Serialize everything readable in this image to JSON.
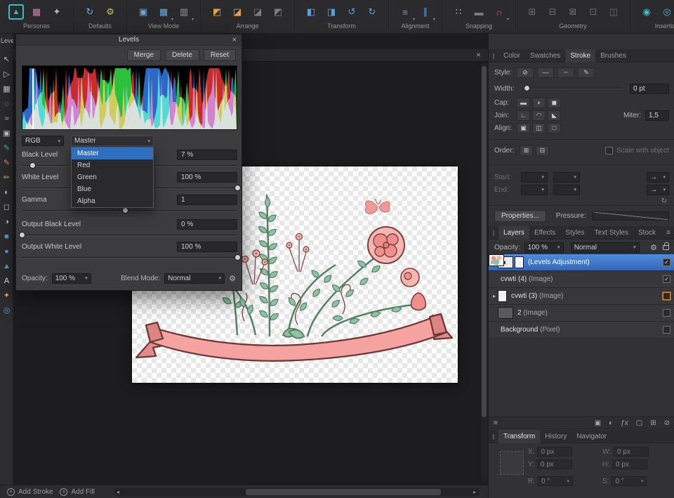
{
  "icons": {
    "close": "×",
    "chevron_down": "▾",
    "caret_right": "▸",
    "check": "✓",
    "gear": "⚙",
    "menu": "≡",
    "half_circle": "◐",
    "plus": "+",
    "tri_left": "◂",
    "tri_right": "▸",
    "handle": "∥",
    "arrow_right": "→",
    "refresh": "↻"
  },
  "window": {
    "clipped_panel_label": "Level"
  },
  "toolbar": {
    "groups": [
      {
        "label": "Personas",
        "icons": [
          {
            "name": "affinity-photo-logo-icon",
            "glyph": "▲",
            "color": "#35c0c8",
            "boxed": true
          },
          {
            "name": "persona-develop-icon",
            "glyph": "▦",
            "color": "#c585b5"
          },
          {
            "name": "persona-export-icon",
            "glyph": "✦",
            "color": "#b9b9b9"
          }
        ]
      },
      {
        "label": "Defaults",
        "icons": [
          {
            "name": "defaults-sync-icon",
            "glyph": "↻",
            "color": "#6fa8dc"
          },
          {
            "name": "defaults-revert-icon",
            "glyph": "⚙",
            "color": "#d4b95e"
          }
        ]
      },
      {
        "label": "View Mode",
        "icons": [
          {
            "name": "view-mode-vector-icon",
            "glyph": "▣",
            "color": "#6fa8dc"
          },
          {
            "name": "view-mode-pixel-icon",
            "glyph": "▦",
            "color": "#6fa8dc",
            "arrow": true
          },
          {
            "name": "view-mode-retina-icon",
            "glyph": "▥",
            "color": "#9a9a9a",
            "arrow": true
          }
        ]
      },
      {
        "label": "Arrange",
        "icons": [
          {
            "name": "arrange-to-front-icon",
            "glyph": "◩",
            "color": "#e8a33d"
          },
          {
            "name": "arrange-forward-icon",
            "glyph": "◪",
            "color": "#e8a33d"
          },
          {
            "name": "arrange-backward-icon",
            "glyph": "◪",
            "color": "#7c7c7c"
          },
          {
            "name": "arrange-to-back-icon",
            "glyph": "◩",
            "color": "#7c7c7c"
          }
        ]
      },
      {
        "label": "Transform",
        "icons": [
          {
            "name": "flip-horizontal-icon",
            "glyph": "◧",
            "color": "#5a9fdc"
          },
          {
            "name": "flip-vertical-icon",
            "glyph": "◨",
            "color": "#5a9fdc"
          },
          {
            "name": "rotate-ccw-icon",
            "glyph": "↺",
            "color": "#5a9fdc"
          },
          {
            "name": "rotate-cw-icon",
            "glyph": "↻",
            "color": "#5a9fdc"
          }
        ]
      },
      {
        "label": "Alignment",
        "icons": [
          {
            "name": "align-horizontal-icon",
            "glyph": "≡",
            "color": "#5a9fdc",
            "arrow": true
          },
          {
            "name": "align-vertical-icon",
            "glyph": "∥",
            "color": "#5a9fdc",
            "arrow": true
          }
        ]
      },
      {
        "label": "Snapping",
        "icons": [
          {
            "name": "snapping-grid-icon",
            "glyph": "∷",
            "color": "#b9b9b9"
          },
          {
            "name": "snapping-toggle-icon",
            "glyph": "▬",
            "color": "#7c7c7c"
          },
          {
            "name": "snapping-magnet-icon",
            "glyph": "∩",
            "color": "#d05c5c",
            "arrow": true
          }
        ]
      },
      {
        "label": "Geometry",
        "icons": [
          {
            "name": "geometry-add-icon",
            "glyph": "⊞",
            "color": "#6e6e6e"
          },
          {
            "name": "geometry-subtract-icon",
            "glyph": "⊟",
            "color": "#6e6e6e"
          },
          {
            "name": "geometry-intersect-icon",
            "glyph": "⊠",
            "color": "#6e6e6e"
          },
          {
            "name": "geometry-divide-icon",
            "glyph": "⊡",
            "color": "#6e6e6e"
          },
          {
            "name": "geometry-combine-icon",
            "glyph": "◫",
            "color": "#6e6e6e"
          }
        ]
      },
      {
        "label": "Insertion",
        "icons": [
          {
            "name": "insert-inside-icon",
            "glyph": "◉",
            "color": "#35c0c8"
          },
          {
            "name": "insert-on-top-icon",
            "glyph": "◎",
            "color": "#35c0c8"
          },
          {
            "name": "insert-behind-icon",
            "glyph": "●",
            "color": "#35c0c8"
          }
        ]
      }
    ]
  },
  "tools": [
    {
      "name": "move-tool",
      "glyph": "↖",
      "color": "#cfcfcf"
    },
    {
      "name": "node-tool",
      "glyph": "▷",
      "color": "#cfcfcf"
    },
    {
      "name": "rectangle-marquee-tool",
      "glyph": "▦",
      "color": "#cfcfcf"
    },
    {
      "name": "freehand-selection-tool",
      "glyph": "◌",
      "color": "#cfcfcf"
    },
    {
      "name": "flood-select-tool",
      "glyph": "≈",
      "color": "#cfcfcf"
    },
    {
      "name": "crop-tool",
      "glyph": "▣",
      "color": "#cfcfcf"
    },
    {
      "name": "selection-brush-tool",
      "glyph": "✎",
      "color": "#3fc3ca"
    },
    {
      "name": "paint-brush-tool",
      "glyph": "✎",
      "color": "#e0907f"
    },
    {
      "name": "pixel-tool",
      "glyph": "✏",
      "color": "#d8b35a"
    },
    {
      "name": "clone-brush-tool",
      "glyph": "◐",
      "color": "#cfcfcf"
    },
    {
      "name": "erase-brush-tool",
      "glyph": "◻",
      "color": "#cfcfcf"
    },
    {
      "name": "dodge-brush-tool",
      "glyph": "◑",
      "color": "#cfcfcf"
    },
    {
      "name": "rectangle-tool",
      "glyph": "■",
      "color": "#5a9fdc"
    },
    {
      "name": "ellipse-tool",
      "glyph": "●",
      "color": "#5a9fdc"
    },
    {
      "name": "triangle-tool",
      "glyph": "▲",
      "color": "#5a9fdc"
    },
    {
      "name": "artistic-text-tool",
      "glyph": "A",
      "color": "#e8e8e8"
    },
    {
      "name": "colour-picker-tool",
      "glyph": "✦",
      "color": "#d8b35a"
    },
    {
      "name": "zoom-tool",
      "glyph": "◎",
      "color": "#5a9fdc"
    }
  ],
  "levels_dialog": {
    "title": "Levels",
    "merge_label": "Merge",
    "delete_label": "Delete",
    "reset_label": "Reset",
    "channel_select": {
      "value": "RGB"
    },
    "channel_dropdown": {
      "value": "Master",
      "options": [
        "Master",
        "Red",
        "Green",
        "Blue",
        "Alpha"
      ],
      "selected_index": 0
    },
    "sliders": [
      {
        "label": "Black Level",
        "value": "7 %",
        "position_pct": 5
      },
      {
        "label": "White Level",
        "value": "100 %",
        "position_pct": 100
      },
      {
        "label": "Gamma",
        "value": "1",
        "position_pct": 48
      },
      {
        "label": "Output Black Level",
        "value": "0 %",
        "position_pct": 0
      },
      {
        "label": "Output White Level",
        "value": "100 %",
        "position_pct": 100
      }
    ],
    "footer": {
      "opacity_label": "Opacity:",
      "opacity_value": "100 %",
      "blend_label": "Blend Mode:",
      "blend_value": "Normal"
    }
  },
  "right_panel": {
    "tabs": {
      "items": [
        "Color",
        "Swatches",
        "Stroke",
        "Brushes"
      ],
      "active": 2
    },
    "stroke": {
      "style_label": "Style:",
      "style_buttons": [
        {
          "name": "style-none-icon",
          "glyph": "⊘"
        },
        {
          "name": "style-solid-icon",
          "glyph": "—"
        },
        {
          "name": "style-dash-icon",
          "glyph": "╌"
        },
        {
          "name": "style-texture-icon",
          "glyph": "✎"
        }
      ],
      "width_label": "Width:",
      "width_value": "0 pt",
      "cap_label": "Cap:",
      "cap_buttons": [
        {
          "name": "cap-butt-icon",
          "glyph": "▬"
        },
        {
          "name": "cap-round-icon",
          "glyph": "◗"
        },
        {
          "name": "cap-square-icon",
          "glyph": "◼"
        }
      ],
      "join_label": "Join:",
      "join_buttons": [
        {
          "name": "join-miter-icon",
          "glyph": "∟"
        },
        {
          "name": "join-round-icon",
          "glyph": "◠"
        },
        {
          "name": "join-bevel-icon",
          "glyph": "◣"
        }
      ],
      "miter_label": "Miter:",
      "miter_value": "1,5",
      "align_label": "Align:",
      "align_buttons": [
        {
          "name": "align-center-icon",
          "glyph": "▣"
        },
        {
          "name": "align-inside-icon",
          "glyph": "◫"
        },
        {
          "name": "align-outside-icon",
          "glyph": "□"
        }
      ],
      "order_label": "Order:",
      "order_buttons": [
        {
          "name": "order-stroke-front-icon",
          "glyph": "⊞"
        },
        {
          "name": "order-stroke-back-icon",
          "glyph": "⊟"
        }
      ],
      "scale_with_object_label": "Scale with object",
      "start_label": "Start:",
      "end_label": "End:",
      "properties_button": "Properties...",
      "pressure_label": "Pressure:"
    },
    "layers_panel": {
      "tabs": {
        "items": [
          "Layers",
          "Effects",
          "Styles",
          "Text Styles",
          "Stock"
        ],
        "active": 0
      },
      "opacity_label": "Opacity:",
      "opacity_value": "100 %",
      "blend_value": "Normal",
      "layers": [
        {
          "name": "(Levels Adjustment)",
          "thumbs": [
            "adjust",
            "white"
          ],
          "selected": true,
          "checked": true
        },
        {
          "name": "cvwti (4)",
          "type": "(Image)",
          "thumbs": [
            "art"
          ],
          "checked": true
        },
        {
          "name": "cvwti (3)",
          "type": "(Image)",
          "thumbs": [
            "art",
            "white"
          ],
          "has_children": true,
          "checked": false,
          "checkbox_color": "orange"
        },
        {
          "name": "2",
          "type": "(Image)",
          "thumbs": [
            "dark"
          ],
          "checked": false
        },
        {
          "name": "Background",
          "type": "(Pixel)",
          "thumbs": [
            "art"
          ],
          "checked": false
        }
      ],
      "left_action": {
        "name": "layers-stack-icon",
        "glyph": "≡"
      },
      "action_icons": [
        {
          "name": "mask-icon",
          "glyph": "▣"
        },
        {
          "name": "adjustment-icon",
          "glyph": "◐"
        },
        {
          "name": "fx-icon",
          "glyph": "ƒx"
        },
        {
          "name": "new-layer-icon",
          "glyph": "▢"
        },
        {
          "name": "group-icon",
          "glyph": "⊞"
        },
        {
          "name": "delete-layer-icon",
          "glyph": "⊘"
        }
      ]
    },
    "transform_panel": {
      "tabs": {
        "items": [
          "Transform",
          "History",
          "Navigator"
        ],
        "active": 0
      },
      "fields": [
        {
          "label": "X:",
          "value": "0 px"
        },
        {
          "label": "W:",
          "value": "0 px"
        },
        {
          "label": "Y:",
          "value": "0 px"
        },
        {
          "label": "H:",
          "value": "0 px"
        },
        {
          "label": "R:",
          "value": "0 °",
          "dropdown": true
        },
        {
          "label": "S:",
          "value": "0 °",
          "dropdown": true
        }
      ]
    }
  },
  "bottom_bar": {
    "add_stroke": "Add Stroke",
    "add_fill": "Add Fill"
  }
}
